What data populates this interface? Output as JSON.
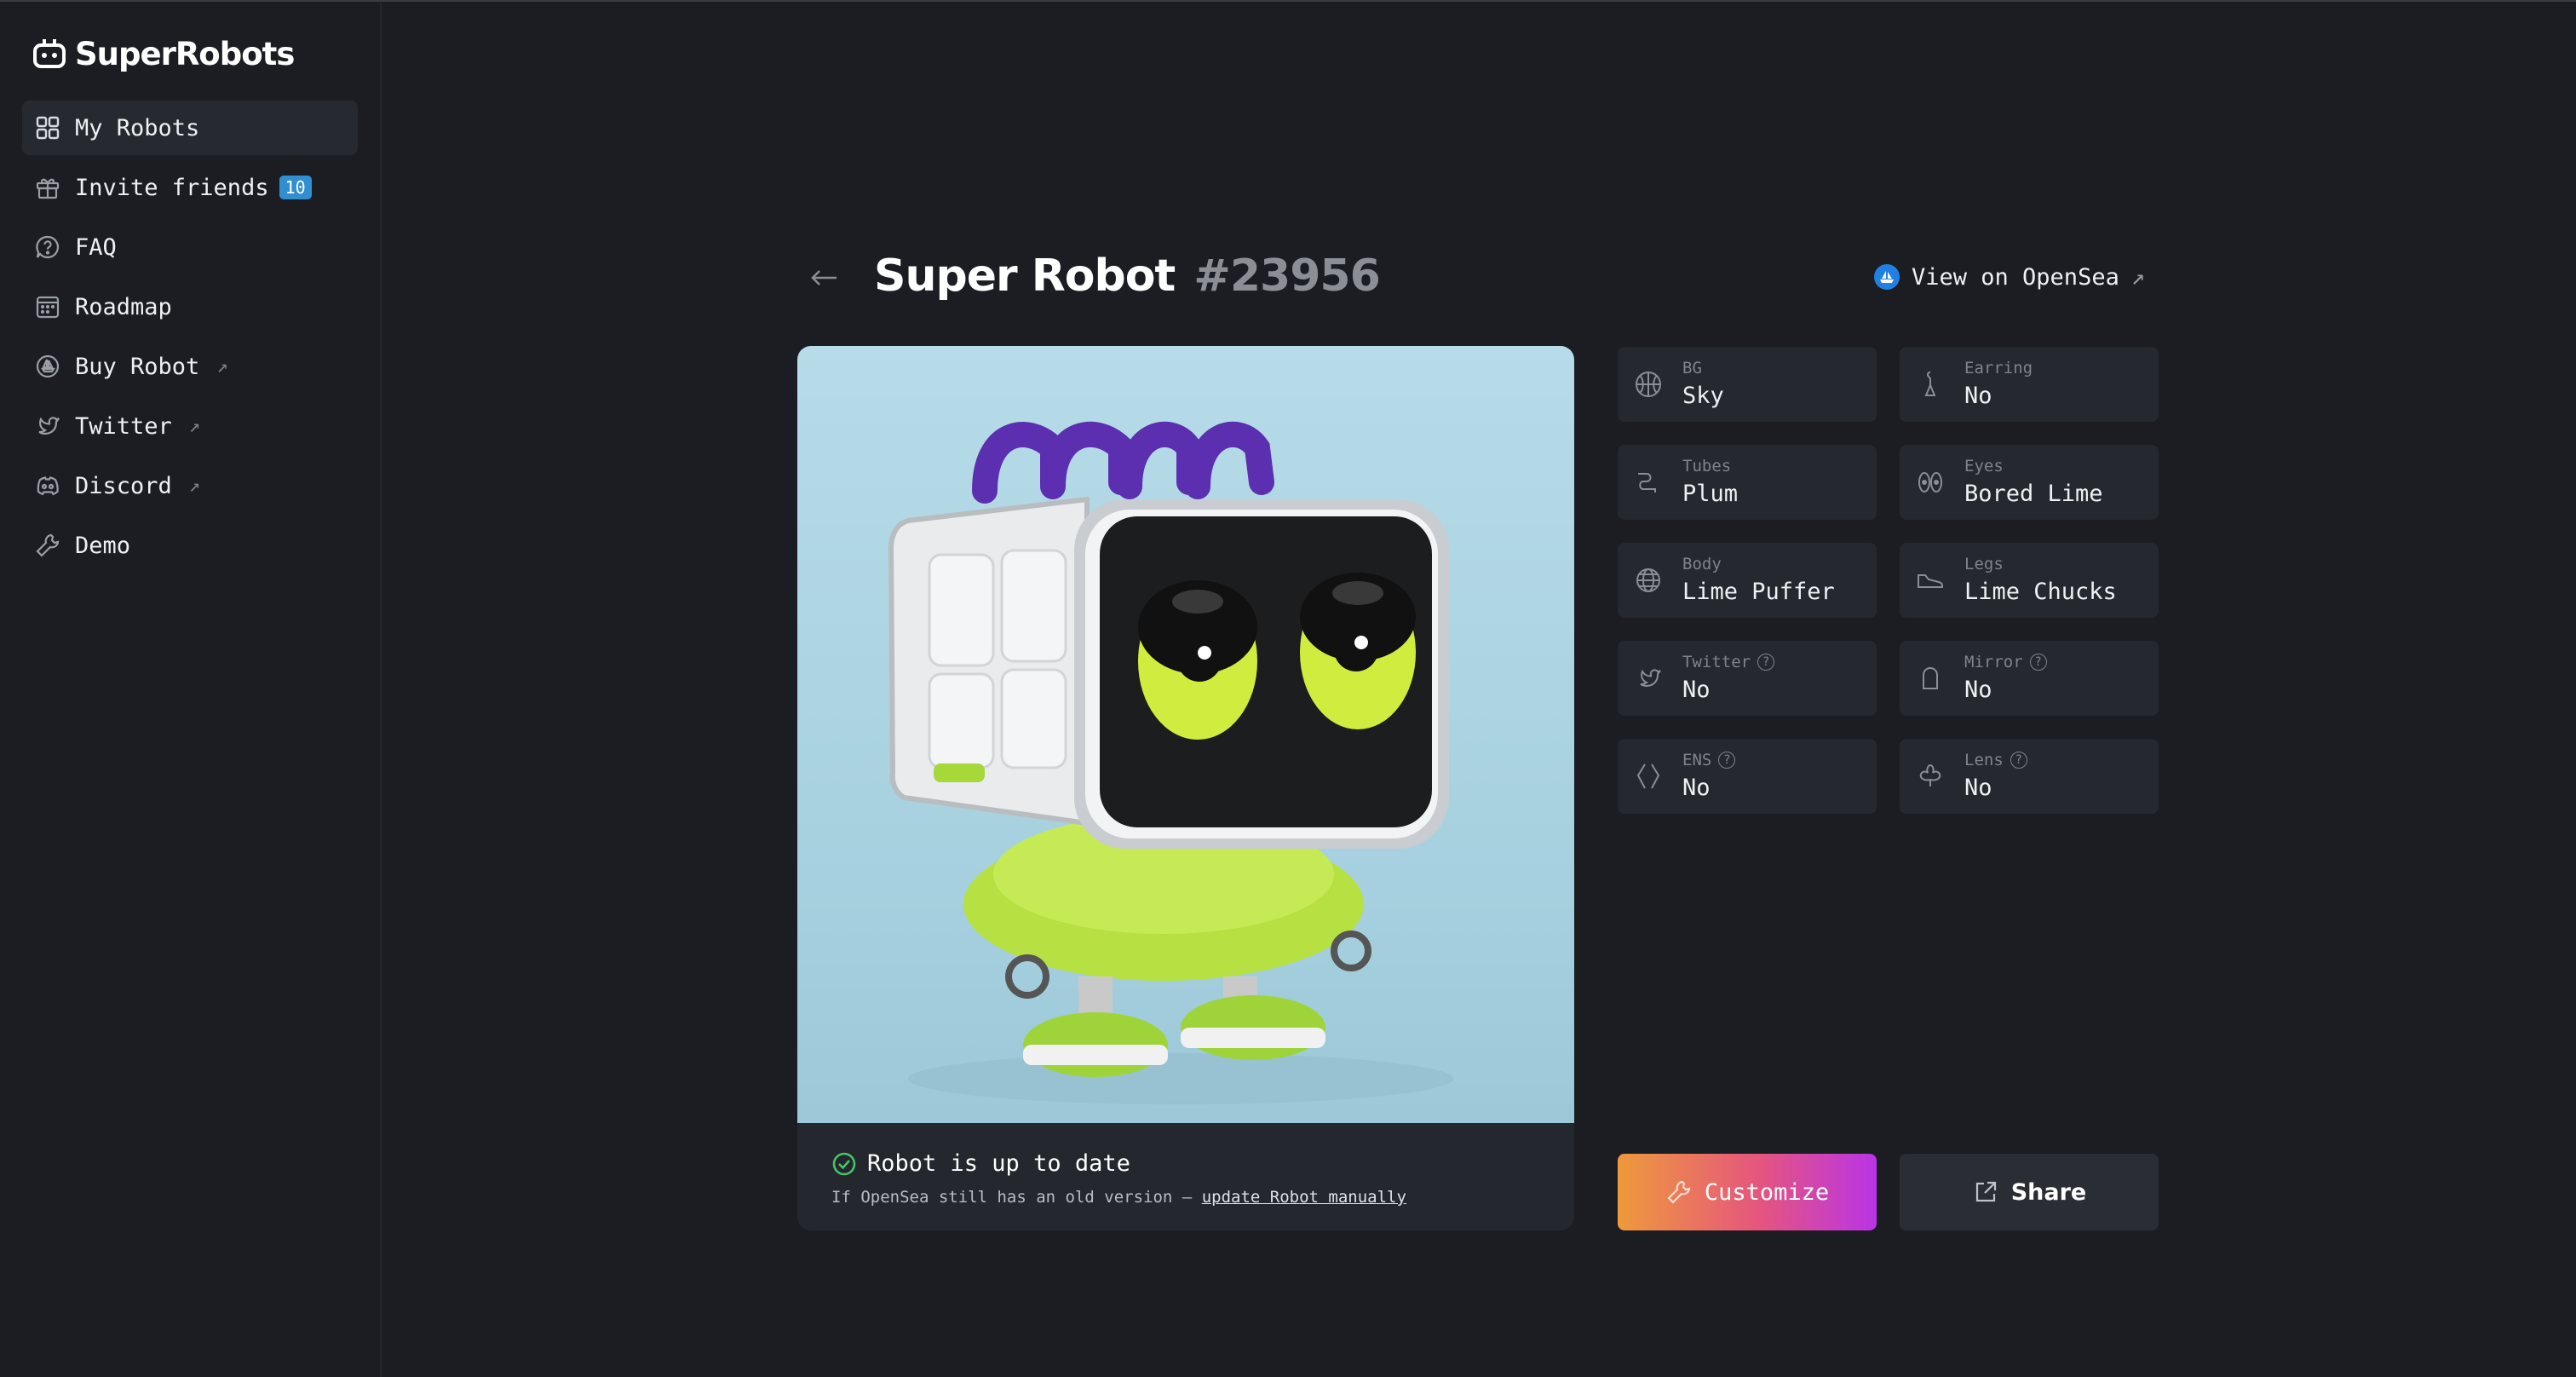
{
  "brand": {
    "name": "SuperRobots"
  },
  "sidebar": {
    "items": [
      {
        "label": "My Robots"
      },
      {
        "label": "Invite friends",
        "badge": "10"
      },
      {
        "label": "FAQ"
      },
      {
        "label": "Roadmap"
      },
      {
        "label": "Buy Robot",
        "external": "↗"
      },
      {
        "label": "Twitter",
        "external": "↗"
      },
      {
        "label": "Discord",
        "external": "↗"
      },
      {
        "label": "Demo"
      }
    ]
  },
  "header": {
    "title": "Super Robot",
    "number": "#23956",
    "opensea_link": "View on OpenSea",
    "opensea_arrow": "↗"
  },
  "status": {
    "title": "Robot is up to date",
    "subtitle_prefix": "If OpenSea still has an old version — ",
    "subtitle_link": "update Robot manually"
  },
  "traits": [
    {
      "label": "BG",
      "value": "Sky",
      "icon": "basketball-icon"
    },
    {
      "label": "Earring",
      "value": "No",
      "icon": "earring-icon"
    },
    {
      "label": "Tubes",
      "value": "Plum",
      "icon": "tube-icon"
    },
    {
      "label": "Eyes",
      "value": "Bored Lime",
      "icon": "eyes-icon"
    },
    {
      "label": "Body",
      "value": "Lime Puffer",
      "icon": "globe-body-icon"
    },
    {
      "label": "Legs",
      "value": "Lime Chucks",
      "icon": "sneaker-icon"
    },
    {
      "label": "Twitter",
      "value": "No",
      "icon": "twitter-bird-icon",
      "help": "?"
    },
    {
      "label": "Mirror",
      "value": "No",
      "icon": "mirror-icon",
      "help": "?"
    },
    {
      "label": "ENS",
      "value": "No",
      "icon": "ens-icon",
      "help": "?"
    },
    {
      "label": "Lens",
      "value": "No",
      "icon": "lens-plant-icon",
      "help": "?"
    }
  ],
  "buttons": {
    "customize": "Customize",
    "share": "Share"
  },
  "colors": {
    "background": "#1b1d22",
    "card": "#25282e",
    "accent_badge": "#2f8fd0",
    "status_ok": "#46c46a"
  }
}
